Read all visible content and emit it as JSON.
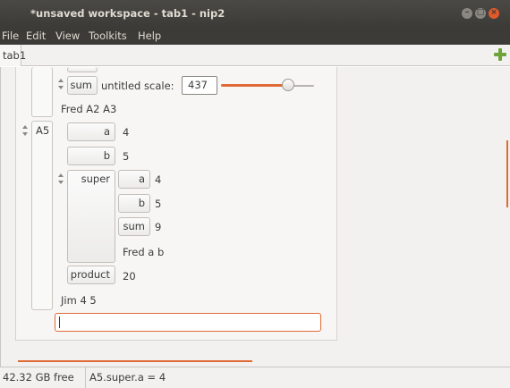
{
  "window": {
    "title": "*unsaved workspace - tab1 - nip2"
  },
  "menu": {
    "file": "File",
    "edit": "Edit",
    "view": "View",
    "toolkits": "Toolkits",
    "help": "Help"
  },
  "tabs": [
    {
      "label": "tab1"
    }
  ],
  "colors": {
    "accent": "#e06a36",
    "titlebar": "#3c3b37",
    "add_icon": "#6ea43a"
  },
  "workspace": {
    "top_row": {
      "button": "sum",
      "label": "untitled scale:",
      "value": "437",
      "slider_fraction": 0.82
    },
    "caption_a2a3": "Fred A2 A3",
    "a5": {
      "name": "A5",
      "a": {
        "button": "a",
        "value": "4"
      },
      "b": {
        "button": "b",
        "value": "5"
      },
      "super": {
        "button": "super",
        "a": {
          "button": "a",
          "value": "4"
        },
        "b": {
          "button": "b",
          "value": "5"
        },
        "sum": {
          "button": "sum",
          "value": "9"
        },
        "caption": "Fred a b"
      },
      "product": {
        "button": "product",
        "value": "20"
      },
      "caption": "Jim 4 5"
    },
    "command_input": ""
  },
  "status": {
    "free": "42.32 GB free",
    "message": "A5.super.a = 4"
  }
}
